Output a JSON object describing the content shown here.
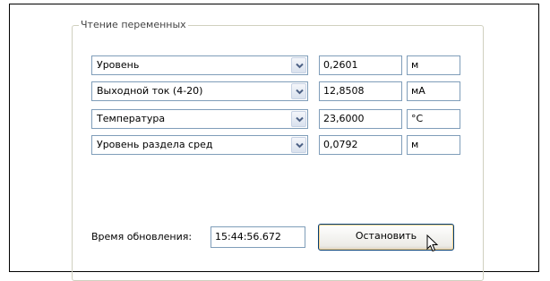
{
  "groupbox": {
    "title": "Чтение переменных"
  },
  "rows": [
    {
      "variable": "Уровень",
      "value": "0,2601",
      "unit": "м"
    },
    {
      "variable": "Выходной ток (4-20)",
      "value": "12,8508",
      "unit": "мА"
    },
    {
      "variable": "Температура",
      "value": "23,6000",
      "unit": "°C"
    },
    {
      "variable": "Уровень раздела сред",
      "value": "0,0792",
      "unit": "м"
    }
  ],
  "update": {
    "label": "Время обновления:",
    "time": "15:44:56.672"
  },
  "stop_button": {
    "label": "Остановить"
  },
  "icons": {
    "dropdown": "chevron-down-icon",
    "cursor": "mouse-pointer-icon"
  }
}
